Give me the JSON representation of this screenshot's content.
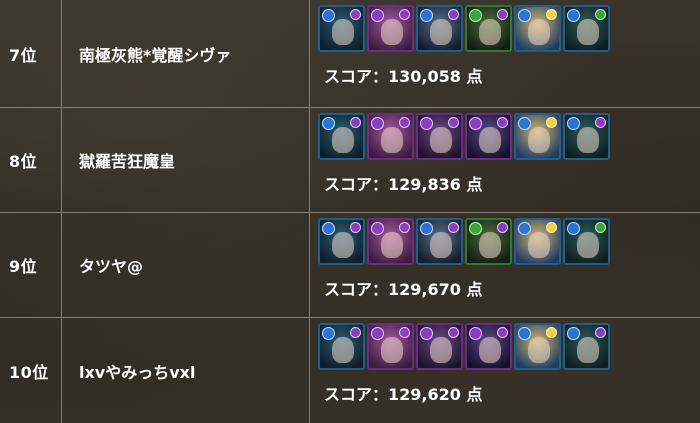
{
  "colors": {
    "blue_frame": "#1f5f8f",
    "purple_frame": "#6d2a8a",
    "green_frame": "#2e7a2e",
    "water_orb": "#2b74d6",
    "dark_orb": "#8a3cc2",
    "wood_orb": "#37a836",
    "light_orb": "#f2d23a"
  },
  "score_prefix": "スコア：",
  "score_suffix": "点",
  "rows": [
    {
      "rank": "7位",
      "player": "南極灰熊*覚醒シヴァ",
      "score": "130,058",
      "team": [
        {
          "icon": "water-dark-monster-icon",
          "attr": "water",
          "sub": "dark",
          "frame": "blue",
          "bg1": "#2a5c73",
          "bg2": "#0e1e2a"
        },
        {
          "icon": "dark-dark-monster-icon",
          "attr": "dark",
          "sub": "dark",
          "frame": "purple",
          "bg1": "#a45a9e",
          "bg2": "#3c1c3c"
        },
        {
          "icon": "water-dark-knight-icon",
          "attr": "water",
          "sub": "dark",
          "frame": "blue",
          "bg1": "#5a6e8c",
          "bg2": "#141c2c"
        },
        {
          "icon": "wood-dark-monster-icon",
          "attr": "wood",
          "sub": "dark",
          "frame": "green",
          "bg1": "#4a6e3c",
          "bg2": "#141c14"
        },
        {
          "icon": "water-light-monster-icon",
          "attr": "water",
          "sub": "light",
          "frame": "blue",
          "bg1": "#d2b46e",
          "bg2": "#1e3c64"
        },
        {
          "icon": "water-wood-monster-icon",
          "attr": "water",
          "sub": "wood",
          "frame": "blue",
          "bg1": "#2a5c5c",
          "bg2": "#0e1e1e"
        }
      ]
    },
    {
      "rank": "8位",
      "player": "獄羅苦狂魔皇",
      "score": "129,836",
      "team": [
        {
          "icon": "water-dark-monster-icon",
          "attr": "water",
          "sub": "dark",
          "frame": "blue",
          "bg1": "#2a5c73",
          "bg2": "#0e1e2a"
        },
        {
          "icon": "dark-dark-monster-icon",
          "attr": "dark",
          "sub": "dark",
          "frame": "purple",
          "bg1": "#a45a9e",
          "bg2": "#3c1c3c"
        },
        {
          "icon": "dark-dark-knight-icon",
          "attr": "dark",
          "sub": "dark",
          "frame": "purple",
          "bg1": "#6e4a8c",
          "bg2": "#1c1428"
        },
        {
          "icon": "dark-dark-dragon-icon",
          "attr": "dark",
          "sub": "dark",
          "frame": "purple",
          "bg1": "#5a4a8c",
          "bg2": "#141028"
        },
        {
          "icon": "water-light-monster-icon",
          "attr": "water",
          "sub": "light",
          "frame": "blue",
          "bg1": "#d2b46e",
          "bg2": "#1e3c64"
        },
        {
          "icon": "water-dark-monster-icon",
          "attr": "water",
          "sub": "dark",
          "frame": "blue",
          "bg1": "#2a5c5c",
          "bg2": "#0e1e1e"
        }
      ]
    },
    {
      "rank": "9位",
      "player": "タツヤ@",
      "score": "129,670",
      "team": [
        {
          "icon": "water-dark-monster-icon",
          "attr": "water",
          "sub": "dark",
          "frame": "blue",
          "bg1": "#2a5c73",
          "bg2": "#0e1e2a"
        },
        {
          "icon": "dark-dark-monster-icon",
          "attr": "dark",
          "sub": "dark",
          "frame": "purple",
          "bg1": "#a45a9e",
          "bg2": "#3c1c3c"
        },
        {
          "icon": "water-dark-knight-icon",
          "attr": "water",
          "sub": "dark",
          "frame": "blue",
          "bg1": "#5a6e8c",
          "bg2": "#141c2c"
        },
        {
          "icon": "wood-dark-monster-icon",
          "attr": "wood",
          "sub": "dark",
          "frame": "green",
          "bg1": "#4a6e3c",
          "bg2": "#141c14"
        },
        {
          "icon": "water-light-monster-icon",
          "attr": "water",
          "sub": "light",
          "frame": "blue",
          "bg1": "#d2b46e",
          "bg2": "#1e3c64"
        },
        {
          "icon": "water-wood-monster-icon",
          "attr": "water",
          "sub": "wood",
          "frame": "blue",
          "bg1": "#2a5c5c",
          "bg2": "#0e1e1e"
        }
      ]
    },
    {
      "rank": "10位",
      "player": "lxvやみっちvxl",
      "score": "129,620",
      "team": [
        {
          "icon": "water-dark-monster-icon",
          "attr": "water",
          "sub": "dark",
          "frame": "blue",
          "bg1": "#2a5c73",
          "bg2": "#0e1e2a"
        },
        {
          "icon": "dark-dark-monster-icon",
          "attr": "dark",
          "sub": "dark",
          "frame": "purple",
          "bg1": "#a45a9e",
          "bg2": "#3c1c3c"
        },
        {
          "icon": "dark-dark-knight-icon",
          "attr": "dark",
          "sub": "dark",
          "frame": "purple",
          "bg1": "#6e4a8c",
          "bg2": "#1c1428"
        },
        {
          "icon": "dark-dark-dragon-icon",
          "attr": "dark",
          "sub": "dark",
          "frame": "purple",
          "bg1": "#5a4a8c",
          "bg2": "#141028"
        },
        {
          "icon": "water-light-monster-icon",
          "attr": "water",
          "sub": "light",
          "frame": "blue",
          "bg1": "#d2b46e",
          "bg2": "#1e3c64"
        },
        {
          "icon": "water-dark-monster-icon",
          "attr": "water",
          "sub": "dark",
          "frame": "blue",
          "bg1": "#2a5c5c",
          "bg2": "#0e1e1e"
        }
      ]
    }
  ]
}
